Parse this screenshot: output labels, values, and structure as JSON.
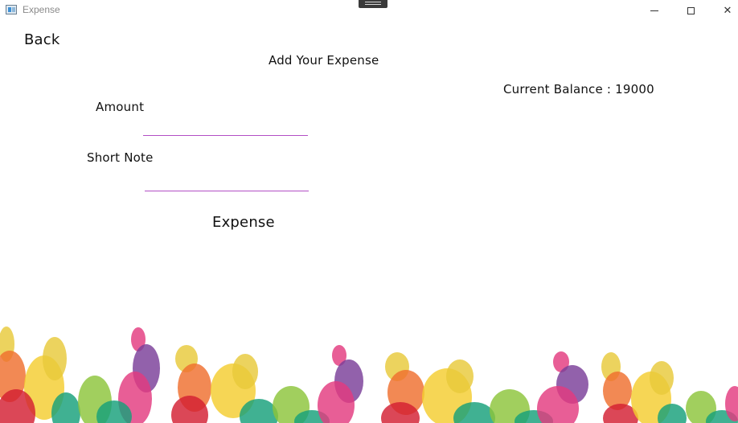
{
  "window": {
    "title": "Expense",
    "icon": "app-window-icon"
  },
  "controls": {
    "minimize_icon": "minimize-icon",
    "maximize_icon": "maximize-icon",
    "close_icon": "close-icon",
    "close_glyph": "✕"
  },
  "page": {
    "back_label": "Back",
    "heading": "Add Your Expense",
    "balance_text": "Current Balance : 19000"
  },
  "form": {
    "amount_label": "Amount",
    "amount_value": "",
    "note_label": "Short Note",
    "note_value": "",
    "submit_label": "Expense"
  },
  "theme": {
    "underline_color": "#b24fc5",
    "bubble_colors": [
      "#e8c93b",
      "#ef6f2e",
      "#8cc43b",
      "#e33b7f",
      "#7a3e98",
      "#d31f32",
      "#16a07a",
      "#f4cd2f"
    ]
  }
}
